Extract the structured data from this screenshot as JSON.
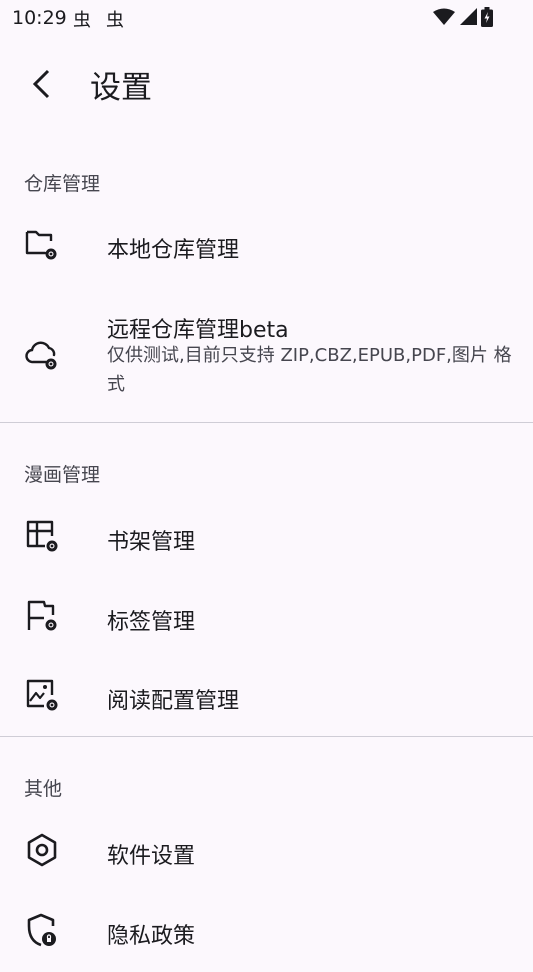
{
  "status": {
    "time": "10:29",
    "notif_icons": [
      "虫",
      "虫"
    ]
  },
  "header": {
    "title": "设置"
  },
  "sections": [
    {
      "header": "仓库管理",
      "items": [
        {
          "icon": "folder-settings-icon",
          "title": "本地仓库管理"
        },
        {
          "icon": "cloud-settings-icon",
          "title": "远程仓库管理beta",
          "subtitle": "仅供测试,目前只支持 ZIP,CBZ,EPUB,PDF,图片 格式"
        }
      ]
    },
    {
      "header": "漫画管理",
      "items": [
        {
          "icon": "shelf-settings-icon",
          "title": "书架管理"
        },
        {
          "icon": "flag-settings-icon",
          "title": "标签管理"
        },
        {
          "icon": "image-settings-icon",
          "title": "阅读配置管理"
        }
      ]
    },
    {
      "header": "其他",
      "items": [
        {
          "icon": "hexagon-settings-icon",
          "title": "软件设置"
        },
        {
          "icon": "shield-privacy-icon",
          "title": "隐私政策"
        }
      ]
    }
  ]
}
